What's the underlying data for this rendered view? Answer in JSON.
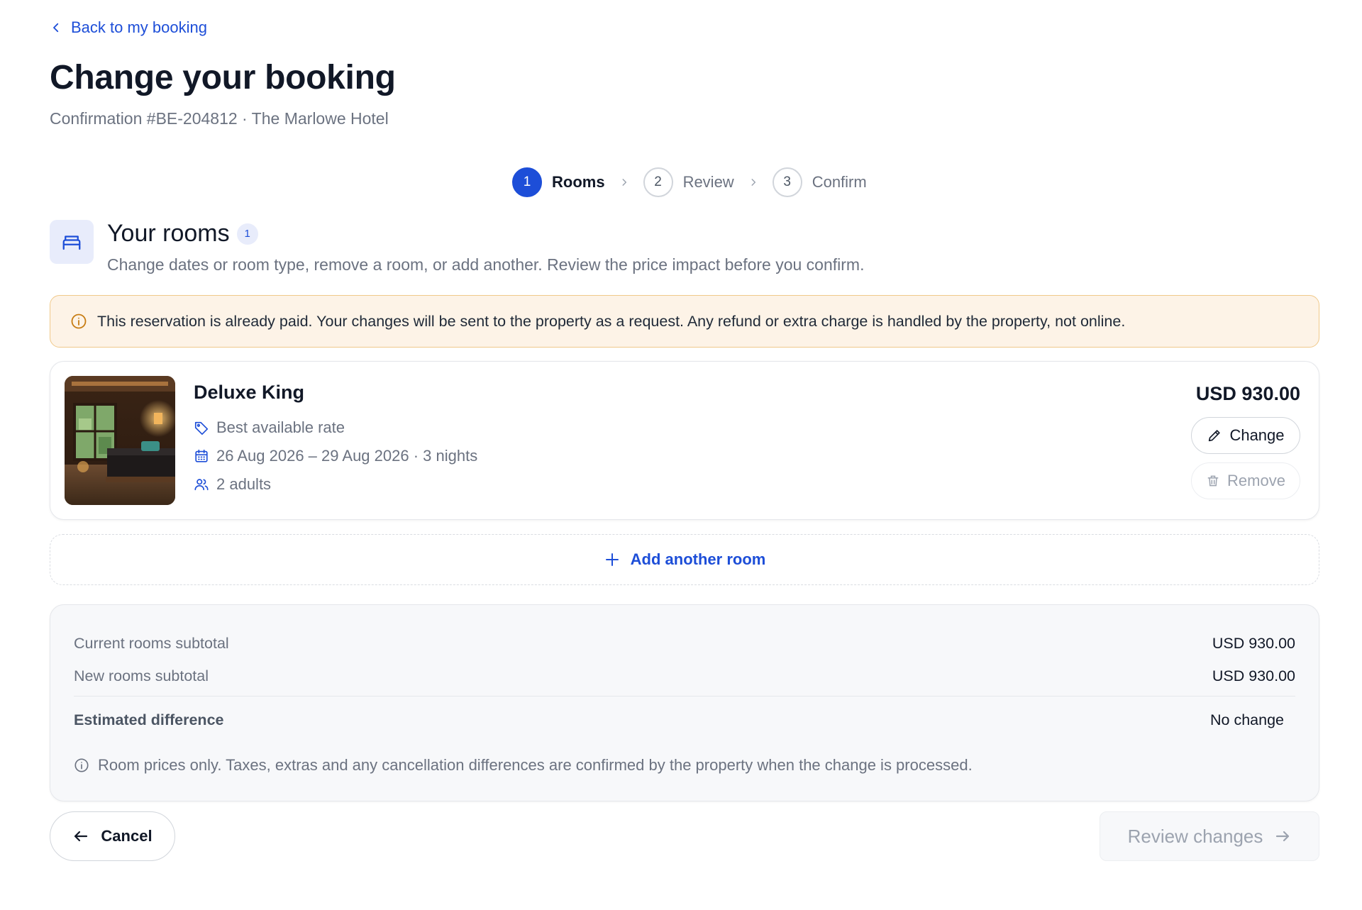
{
  "nav": {
    "back_label": "Back to my booking"
  },
  "header": {
    "title": "Change your booking",
    "subtitle": "Confirmation #BE-204812 · The Marlowe Hotel"
  },
  "stepper": {
    "steps": [
      {
        "number": "1",
        "label": "Rooms",
        "active": true
      },
      {
        "number": "2",
        "label": "Review",
        "active": false
      },
      {
        "number": "3",
        "label": "Confirm",
        "active": false
      }
    ]
  },
  "section": {
    "title": "Your rooms",
    "count": "1",
    "description": "Change dates or room type, remove a room, or add another. Review the price impact before you confirm.",
    "icon": "bed-icon"
  },
  "notice": {
    "text": "This reservation is already paid. Your changes will be sent to the property as a request. Any refund or extra charge is handled by the property, not online.",
    "color": "#fdf3e7"
  },
  "rooms": [
    {
      "name": "Deluxe King",
      "rate": "Best available rate",
      "dates": "26 Aug 2026 – 29 Aug 2026 · 3 nights",
      "guests": "2 adults",
      "price": "USD 930.00",
      "change_label": "Change",
      "remove_label": "Remove"
    }
  ],
  "add_room_label": "Add another room",
  "summary": {
    "current_label": "Current rooms subtotal",
    "current_value": "USD 930.00",
    "new_label": "New rooms subtotal",
    "new_value": "USD 930.00",
    "difference_label": "Estimated difference",
    "difference_value": "No change",
    "note": "Room prices only. Taxes, extras and any cancellation differences are confirmed by the property when the change is processed."
  },
  "footer": {
    "cancel_label": "Cancel",
    "review_label": "Review changes"
  },
  "colors": {
    "accent": "#1d4ed8",
    "notice_border": "#f0c98a",
    "text_muted": "#6b7280"
  }
}
